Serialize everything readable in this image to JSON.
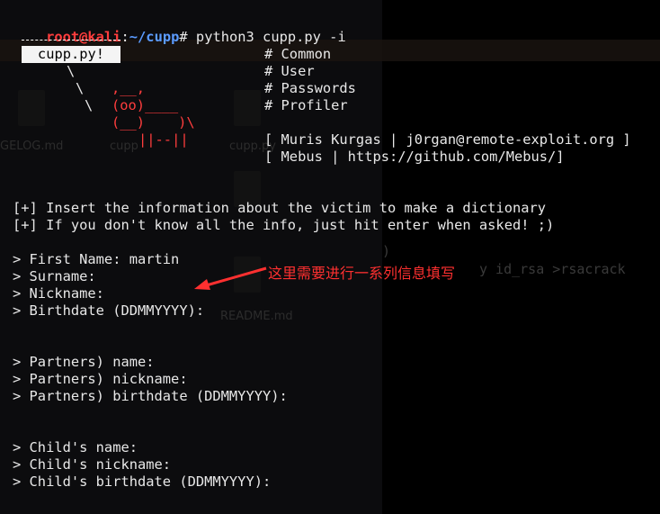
{
  "prompt": {
    "user": "root@kali",
    "sep": ":",
    "path": "~/cupp",
    "symbol": "#",
    "command": " python3 cupp.py -i"
  },
  "banner": {
    "label": "cupp.py!",
    "art": {
      "l1": "\\",
      "l2": "\\",
      "l3": "\\",
      "c1": ",__,",
      "c2": "(oo)____",
      "c3": "(__)    )\\",
      "c4": "||--||"
    },
    "menu": [
      "# Common",
      "# User",
      "# Passwords",
      "# Profiler"
    ],
    "credits": [
      "[ Muris Kurgas | j0rgan@remote-exploit.org ]",
      "[ Mebus | https://github.com/Mebus/]"
    ]
  },
  "info_lines": [
    "[+] Insert the information about the victim to make a dictionary",
    "[+] If you don't know all the info, just hit enter when asked! ;)"
  ],
  "prompts_group1": [
    "> First Name: martin",
    "> Surname:",
    "> Nickname:",
    "> Birthdate (DDMMYYYY):"
  ],
  "prompts_group2": [
    "> Partners) name:",
    "> Partners) nickname:",
    "> Partners) birthdate (DDMMYYYY):"
  ],
  "prompts_group3": [
    "> Child's name:",
    "> Child's nickname:",
    "> Child's birthdate (DDMMYYYY):"
  ],
  "annotation": "这里需要进行一系列信息填写",
  "background": {
    "ghost_files": [
      "GELOG.md",
      "cupp",
      "cupp.py",
      "README.md"
    ],
    "ghost_cmd": "y id_rsa >rsacrack",
    "ghost_paren": ")"
  },
  "colors": {
    "prompt_user": "#ff3d3d",
    "prompt_path": "#5b9bff",
    "annotation": "#ff3030",
    "text": "#e8e8e8"
  }
}
